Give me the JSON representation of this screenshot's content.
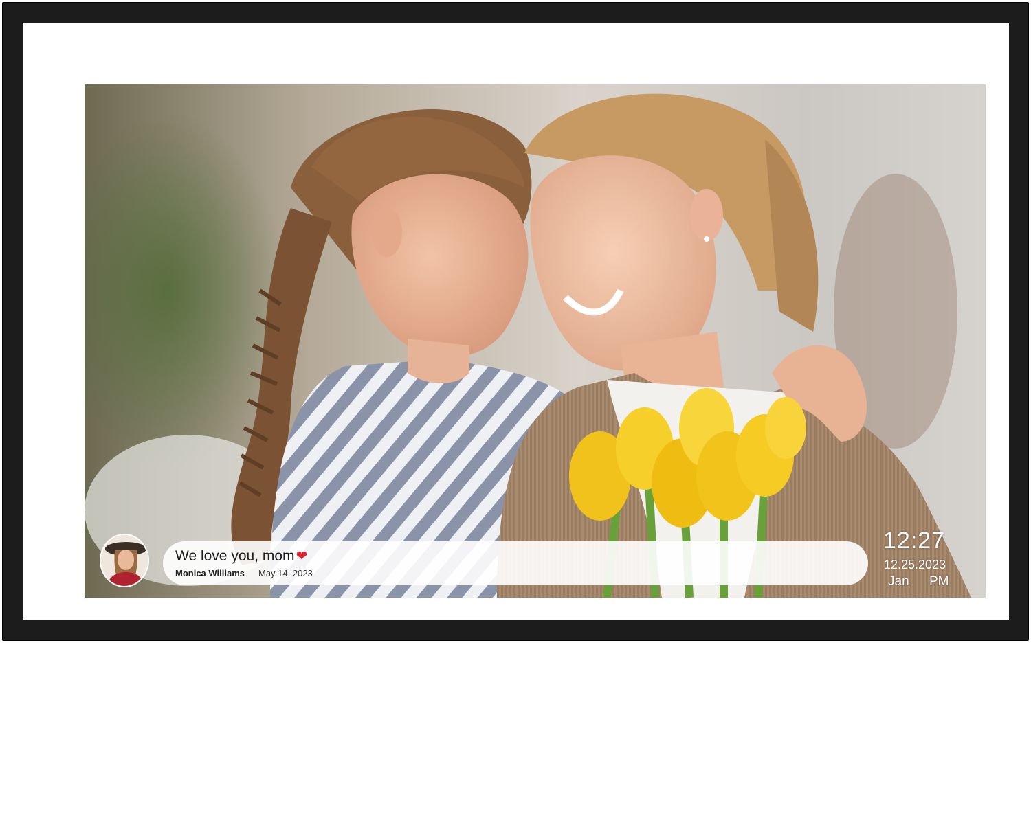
{
  "message": {
    "text": "We love you, mom",
    "emoji": "❤",
    "sender": "Monica Williams",
    "date": "May 14, 2023"
  },
  "clock": {
    "time": "12:27",
    "date": "12.25.2023",
    "month": "Jan",
    "ampm": "PM"
  },
  "icons": {
    "heart": "heart-icon",
    "avatar": "sender-avatar"
  },
  "colors": {
    "frame": "#1c1c1c",
    "mat": "#ffffff",
    "bubble": "#ffffff",
    "heart": "#e0212e",
    "clock_text": "#ffffff"
  }
}
